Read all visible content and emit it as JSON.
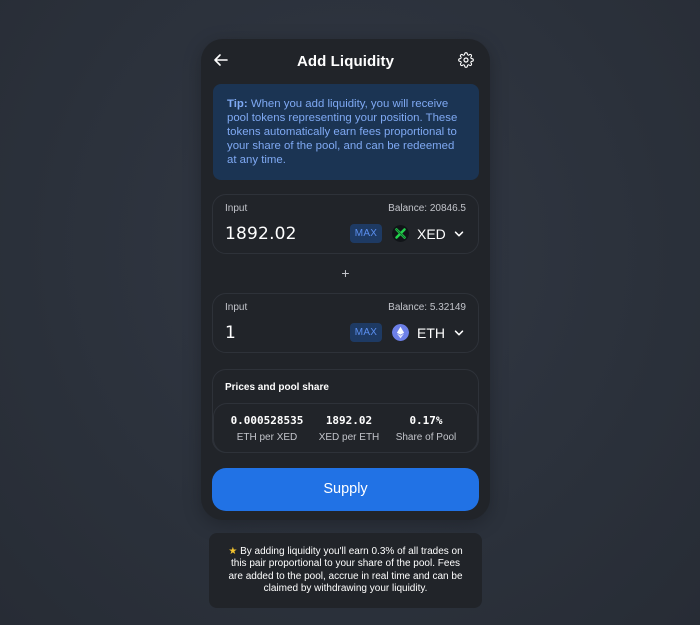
{
  "header": {
    "title": "Add Liquidity",
    "back_icon": "arrow-left-icon",
    "settings_icon": "gear-icon"
  },
  "tip": {
    "bold": "Tip:",
    "text": "When you add liquidity, you will receive pool tokens representing your position. These tokens automatically earn fees proportional to your share of the pool, and can be redeemed at any time."
  },
  "inputs": [
    {
      "label": "Input",
      "balance": "Balance: 20846.5",
      "amount": "1892.02",
      "max_label": "MAX",
      "token": "XED",
      "token_icon": "xed-token-icon"
    },
    {
      "label": "Input",
      "balance": "Balance: 5.32149",
      "amount": "1",
      "max_label": "MAX",
      "token": "ETH",
      "token_icon": "eth-token-icon"
    }
  ],
  "plus": "+",
  "prices": {
    "title": "Prices and pool share",
    "items": [
      {
        "value": "0.000528535",
        "label": "ETH per XED"
      },
      {
        "value": "1892.02",
        "label": "XED per ETH"
      },
      {
        "value": "0.17%",
        "label": "Share of Pool"
      }
    ]
  },
  "supply": {
    "label": "Supply"
  },
  "note": {
    "star": "★",
    "text": "By adding liquidity you'll earn 0.3% of all trades on this pair proportional to your share of the pool. Fees are added to the pool, accrue in real time and can be claimed by withdrawing your liquidity."
  },
  "colors": {
    "background": "#2b313b",
    "card": "#212429",
    "accent": "#2172e5",
    "tip_bg": "#1b3453",
    "tip_text": "#7fa9f3",
    "star": "#f3c32f"
  }
}
